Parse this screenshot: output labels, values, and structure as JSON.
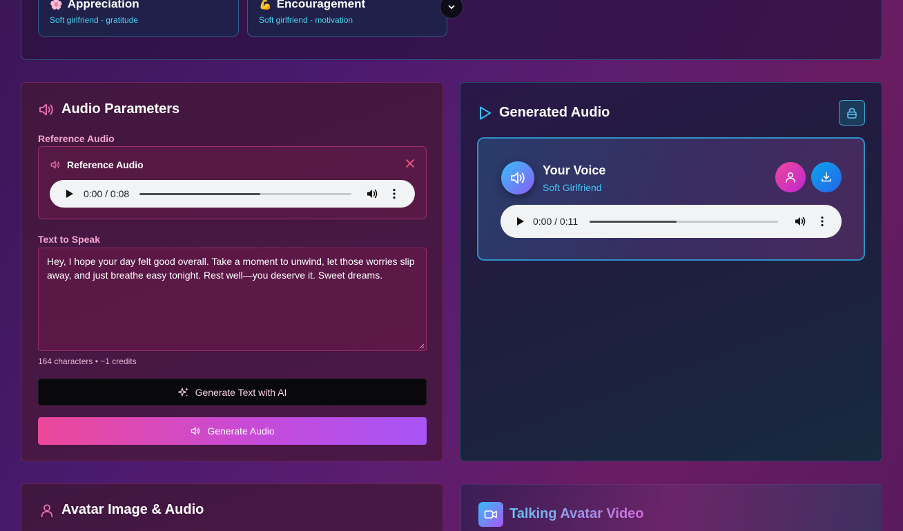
{
  "presets": [
    {
      "emoji": "🌸",
      "title": "Appreciation",
      "subtitle": "Soft girlfriend - gratitude"
    },
    {
      "emoji": "💪",
      "title": "Encouragement",
      "subtitle": "Soft girlfriend - motivation"
    }
  ],
  "audio_params": {
    "heading": "Audio Parameters",
    "reference_label": "Reference Audio",
    "reference_box_title": "Reference Audio",
    "reference_player": {
      "time": "0:00 / 0:08",
      "progress": 0.57
    },
    "text_label": "Text to Speak",
    "text_value": "Hey, I hope your day felt good overall. Take a moment to unwind, let those worries slip away, and just breathe easy tonight. Rest well—you deserve it. Sweet dreams.",
    "counter": "164 characters • ~1 credits",
    "ai_button": "Generate Text with AI",
    "generate_button": "Generate Audio"
  },
  "generated": {
    "heading": "Generated Audio",
    "voice_name": "Your Voice",
    "voice_subtitle": "Soft Girlfriend",
    "player": {
      "time": "0:00 / 0:11",
      "progress": 0.46
    }
  },
  "avatar_section": {
    "heading": "Avatar Image & Audio"
  },
  "video_section": {
    "heading": "Talking Avatar Video"
  },
  "colors": {
    "pink": "#ec4899",
    "cyan": "#38bdf8",
    "purple": "#a855f7"
  }
}
